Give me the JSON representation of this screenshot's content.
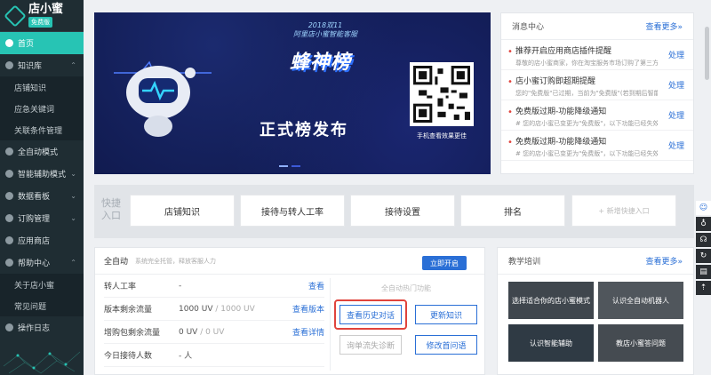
{
  "sidebar": {
    "brand_name": "店小蜜",
    "brand_tag": "免费版",
    "items": [
      {
        "label": "首页",
        "active": true
      },
      {
        "label": "知识库",
        "expanded": true
      },
      {
        "label": "店铺知识",
        "sub": true
      },
      {
        "label": "应急关键词",
        "sub": true
      },
      {
        "label": "关联条件管理",
        "sub": true
      },
      {
        "label": "全自动模式"
      },
      {
        "label": "智能辅助模式"
      },
      {
        "label": "数据看板"
      },
      {
        "label": "订购管理"
      },
      {
        "label": "应用商店"
      },
      {
        "label": "帮助中心",
        "expanded": true
      },
      {
        "label": "关于店小蜜",
        "sub": true
      },
      {
        "label": "常见问题",
        "sub": true
      },
      {
        "label": "操作日志"
      }
    ]
  },
  "banner": {
    "subtitle_line1": "2018双11",
    "subtitle_line2": "阿里店小蜜智能客服",
    "main_title": "蜂神榜",
    "release_text": "正式榜发布",
    "qr_caption": "手机查看效果更佳"
  },
  "notice": {
    "title": "消息中心",
    "more": "查看更多»",
    "items": [
      {
        "title": "推荐开启应用商店插件提醒",
        "desc": "尊敬的店小蜜商家，你在淘宝服务市场订购了第三方E...",
        "action": "处理"
      },
      {
        "title": "店小蜜订购即超期提醒",
        "desc": "您的\"免费版\"已过期，当前为\"免费版\"(若到期后智能...",
        "action": "处理"
      },
      {
        "title": "免费版过期-功能降级通知",
        "desc": "# 您的店小蜜已变更为\"免费版\"，以下功能已经失效...",
        "action": "处理"
      },
      {
        "title": "免费版过期-功能降级通知",
        "desc": "# 您的店小蜜已变更为\"免费版\"，以下功能已经失效...",
        "action": "处理"
      }
    ]
  },
  "quick": {
    "label": "快捷入口",
    "buttons": [
      "店铺知识",
      "接待与转人工率",
      "接待设置",
      "排名"
    ],
    "add_label": "+ 新增快捷入口"
  },
  "auto": {
    "title": "全自动",
    "desc": "系统完全托管，释放客服人力",
    "open_button": "立即开启",
    "stats": [
      {
        "key": "转人工率",
        "value": "-",
        "link": "查看"
      },
      {
        "key": "版本剩余流量",
        "value": "1000 UV",
        "value_muted": " / 1000 UV",
        "link": "查看版本"
      },
      {
        "key": "增购包剩余流量",
        "value": "0 UV",
        "value_muted": " / 0 UV",
        "link": "查看详情"
      },
      {
        "key": "今日接待人数",
        "value": "- 人",
        "link": ""
      }
    ],
    "hot_title": "全自动热门功能",
    "hot_buttons": {
      "history": "查看历史对话",
      "update": "更新知识",
      "diagnose": "询单流失诊断",
      "edit_first": "修改首问语"
    }
  },
  "training": {
    "title": "教学培训",
    "more": "查看更多»",
    "tiles": [
      "选择适合你的店小蜜模式",
      "认识全自动机器人",
      "认识智能辅助",
      "教店小蜜答问题"
    ]
  },
  "colors": {
    "accent": "#27c4b4",
    "link": "#2a6fd6",
    "sidebar_bg": "#1f2d33",
    "alert": "#e0433c"
  }
}
